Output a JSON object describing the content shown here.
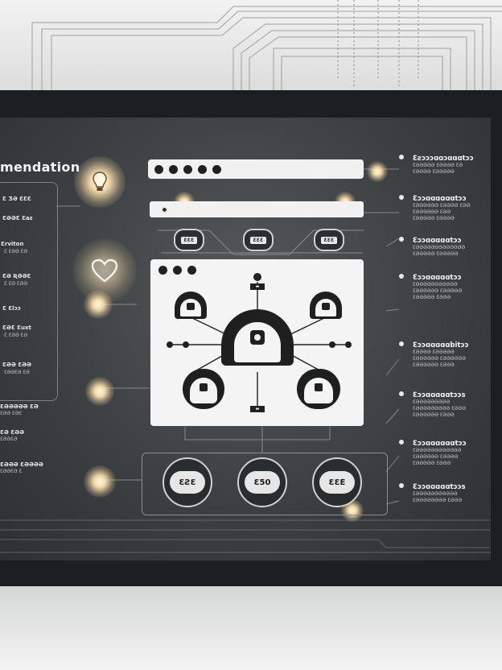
{
  "header": {
    "title": "mendation"
  },
  "left_panel": {
    "items": [
      {
        "label": "Ɛ ƷƏ ƐƐƐ",
        "sub": ""
      },
      {
        "label": "ƐƏƏƐ Ɛaƨ",
        "sub": ""
      },
      {
        "label": "Ɛrviton",
        "sub": "Ɛ ƐƏƏ ƐƏ"
      },
      {
        "label": "ƐƏ ƦƏƏƐ",
        "sub": "Ɛ ƐƏ ƐƏƏ"
      },
      {
        "label": "Ɛ Ɛlɔɔ",
        "sub": ""
      },
      {
        "label": "ƐƏƐ Ɛuxt",
        "sub": "Ɛ ƐƏƏ ƐƏ"
      },
      {
        "label": "ƐƏƏ ƐƏƏ",
        "sub": "ƐƏƏƐƏ ƐƏ"
      }
    ],
    "bottom_items": [
      {
        "label": "ƐƏƏƏƏƏ ƐƏ",
        "sub": "ƐƏƏ ƐƏƐ"
      },
      {
        "label": "ƐƏ ƐƏƏ",
        "sub": "ƐƏƏƐƏ"
      },
      {
        "label": "ƐƏƏƏ ƐƏƏƏƏ",
        "sub": "ƐƏƏƐƏ Ɛ"
      }
    ]
  },
  "chips": [
    "ƐƐƐ",
    "ƐƐƐ",
    "ƐƐƐ"
  ],
  "node_labels": {
    "top": "▬",
    "bottom": "▬"
  },
  "badges": [
    "ƐƧƐ",
    "Ɛ50",
    "ƐƐE"
  ],
  "right_panel": [
    {
      "title": "Ɛƨɔɔɔɑɑɔɑɑɑtɔɔ",
      "subs": [
        "ƐƏƏƏƏƏ ƐƏƏƏƏ ƐƏ",
        "ƐƏƏƏƏ ƐƏƏƏƏƏ"
      ]
    },
    {
      "title": "Ɛɔɔɑɑɑɑɑɑtɔɔ",
      "subs": [
        "ƐƏƏƏƏƏƏ ƐƏƏƏƏ ƐƏƏ",
        "ƐƏƏƏƏƏƏ ƐƏƏ",
        "ƐƏƏƏƏƏ ƐƏƏƏƏ"
      ]
    },
    {
      "title": "Ɛɔɔɑɑɑɑɑtɔɔ",
      "subs": [
        "ƐƏƏƏƏƏƏƏƏƏƏƏƏƏ",
        "ƐƏƏƏƏƏ ƐƏƏƏƏƏ"
      ]
    },
    {
      "title": "Ɛɔɔɑɑɑɑɑtɔɔ",
      "subs": [
        "ƐƏƏƏƏƏƏƏƏƏƏƏ",
        "ƐƏƏƏƏƏƏ ƐƏƏƏƏƏ",
        "ƐƏƏƏƏƏ ƐƏƏƏ"
      ]
    },
    {
      "title": "Ɛɔɔɑɑɑɑɑbitɔɔ",
      "subs": [
        "ƐƏƏƏƏ ƐƏƏƏƏƏ",
        "ƐƏƏƏƏƏƏ ƐƏƏƏƏƏƏ",
        "ƐƏƏƏƏƏƏ ƐƏƏƏ"
      ]
    },
    {
      "title": "Ɛɔɔɑɑɑɑɑtɔɔs",
      "subs": [
        "ƐƏƏƏƏƏƏƏƏƏ",
        "ƐƏƏƏƏƏƏƏƏƏ ƐƏƏƏ",
        "ƐƏƏƏƏƏƏ ƐƏƏƏ"
      ]
    },
    {
      "title": "Ɛɔɔɑɑɑɑɑɑtɔɔ",
      "subs": [
        "ƐƏƏƏƏƏƏƏƏƏƏƏƏ",
        "ƐƏƏƏƏƏƏ ƐƏƏƏƏ",
        "ƐƏƏƏƏƏ ƐƏƏƏ"
      ]
    },
    {
      "title": "Ɛɔɔɑɑɑɑɑtɔɔs",
      "subs": [
        "ƐƏƏƏƏƏƏƏƏƏƏƏ",
        "ƐƏƏƏƏƏƏƏƏ ƐƏƏƏ"
      ]
    }
  ],
  "colors": {
    "screen": "#3c4043",
    "frame": "#1c1f21",
    "window": "#f4f4f4",
    "glow": "#f3d9a8"
  }
}
